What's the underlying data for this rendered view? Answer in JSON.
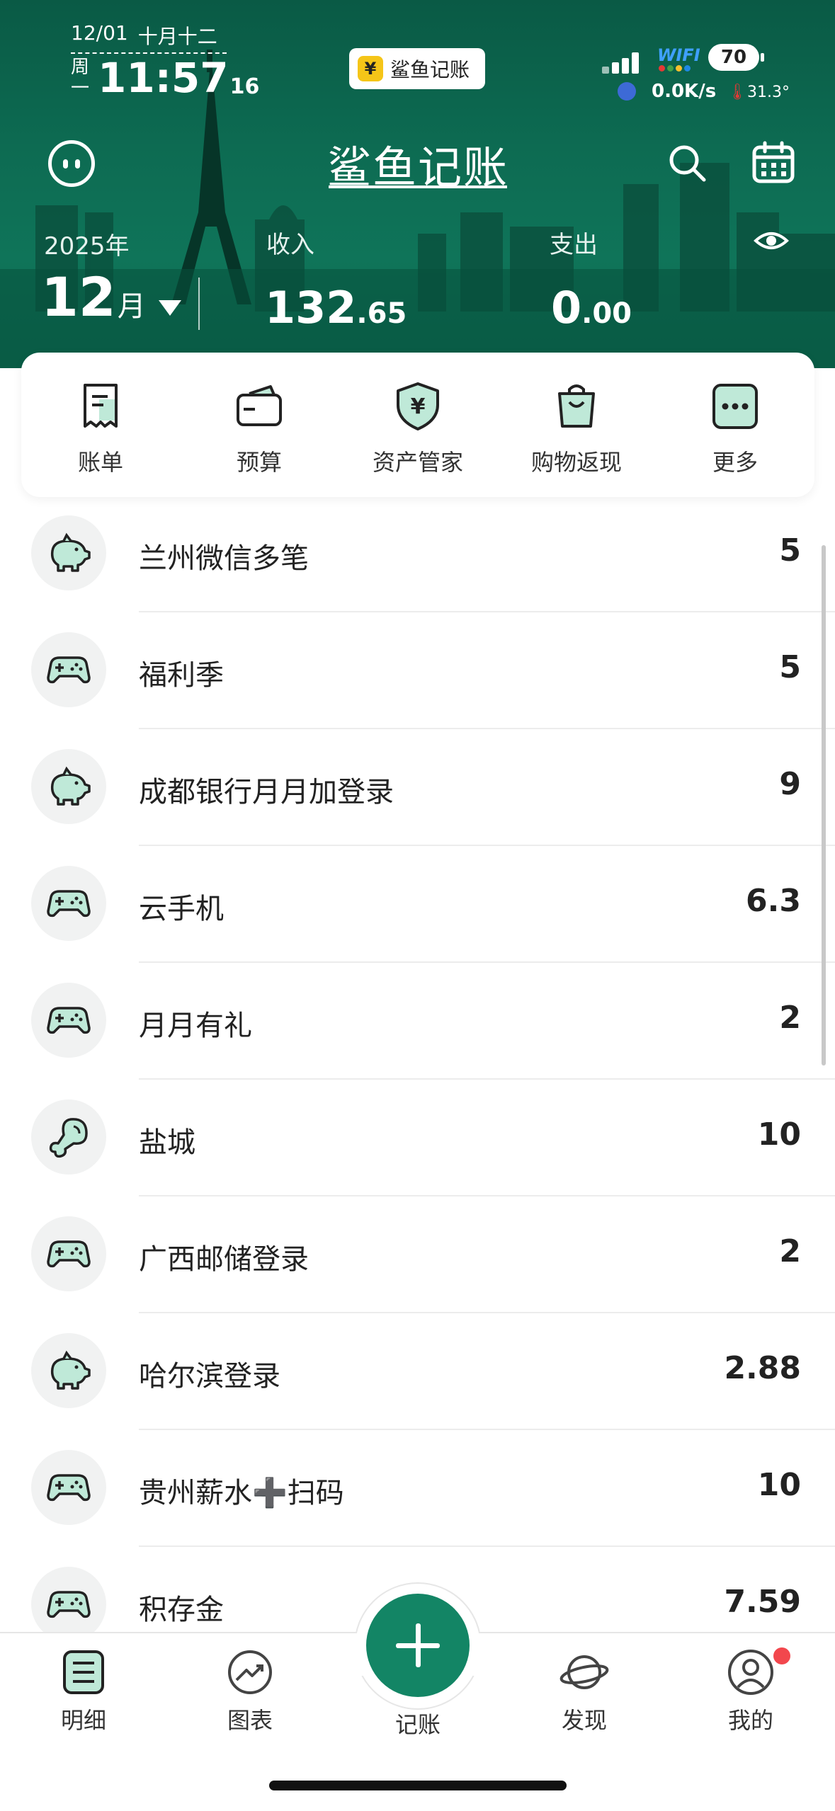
{
  "status_bar": {
    "date": "12/01",
    "lunar": "十月十二",
    "weekday": "周一",
    "time": "11:57",
    "seconds": "16",
    "app_badge": "鲨鱼记账",
    "wifi_label": "WIFI",
    "battery": "70",
    "net_speed": "0.0K/s",
    "temperature": "31.3°"
  },
  "header": {
    "title": "鲨鱼记账",
    "year": "2025年",
    "month": "12",
    "month_unit": "月",
    "income_label": "收入",
    "income_int": "132",
    "income_dec": ".65",
    "expense_label": "支出",
    "expense_int": "0",
    "expense_dec": ".00"
  },
  "quick_menu": [
    {
      "label": "账单",
      "icon": "bill-icon"
    },
    {
      "label": "预算",
      "icon": "wallet-icon"
    },
    {
      "label": "资产管家",
      "icon": "asset-shield-icon"
    },
    {
      "label": "购物返现",
      "icon": "shopping-bag-icon"
    },
    {
      "label": "更多",
      "icon": "more-icon"
    }
  ],
  "records": [
    {
      "name": "兰州微信多笔",
      "amount": "5",
      "icon": "piggy-bank-icon"
    },
    {
      "name": "福利季",
      "amount": "5",
      "icon": "gamepad-icon"
    },
    {
      "name": "成都银行月月加登录",
      "amount": "9",
      "icon": "piggy-bank-icon"
    },
    {
      "name": "云手机",
      "amount": "6.3",
      "icon": "gamepad-icon"
    },
    {
      "name": "月月有礼",
      "amount": "2",
      "icon": "gamepad-icon"
    },
    {
      "name": "盐城",
      "amount": "10",
      "icon": "drumstick-icon"
    },
    {
      "name": "广西邮储登录",
      "amount": "2",
      "icon": "gamepad-icon"
    },
    {
      "name": "哈尔滨登录",
      "amount": "2.88",
      "icon": "piggy-bank-icon"
    },
    {
      "name": "贵州薪水➕扫码",
      "amount": "10",
      "icon": "gamepad-icon"
    },
    {
      "name": "积存金",
      "amount": "7.59",
      "icon": "gamepad-icon"
    }
  ],
  "tabbar": [
    {
      "label": "明细",
      "icon": "list-detail-icon"
    },
    {
      "label": "图表",
      "icon": "chart-trend-icon"
    },
    {
      "label": "记账",
      "icon": "add-icon"
    },
    {
      "label": "发现",
      "icon": "planet-icon"
    },
    {
      "label": "我的",
      "icon": "profile-icon"
    }
  ],
  "colors": {
    "brand_green": "#0d6b52",
    "fab_green": "#138565",
    "icon_mint": "#bfe9d8",
    "notification_red": "#f2474d"
  }
}
